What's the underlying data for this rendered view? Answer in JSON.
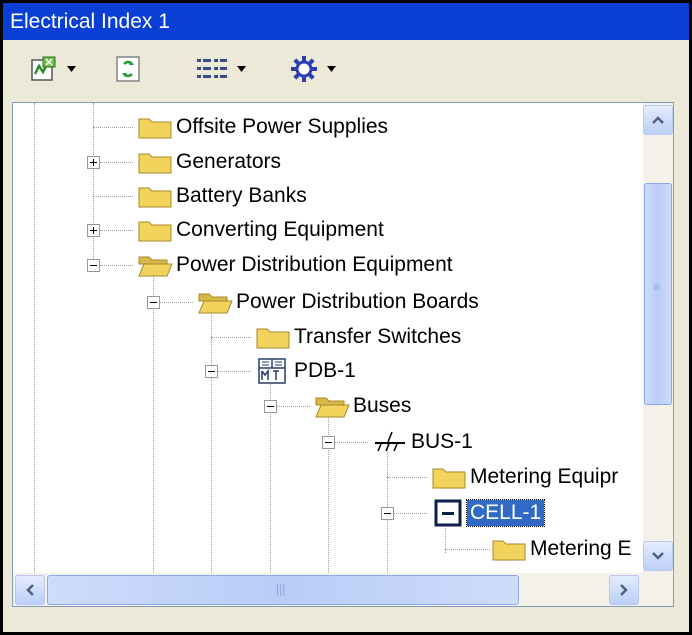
{
  "window": {
    "title": "Electrical Index 1"
  },
  "toolbar": {
    "buttons": [
      {
        "icon": "index-add-icon",
        "dropdown": true
      },
      {
        "icon": "refresh-icon",
        "dropdown": false
      },
      {
        "icon": "list-view-icon",
        "dropdown": true
      },
      {
        "icon": "gear-icon",
        "dropdown": true
      }
    ]
  },
  "tree": {
    "nodes": [
      {
        "label": "Offsite Power Supplies",
        "icon": "folder-icon",
        "expander": "none"
      },
      {
        "label": "Generators",
        "icon": "folder-icon",
        "expander": "plus"
      },
      {
        "label": "Battery Banks",
        "icon": "folder-icon",
        "expander": "none"
      },
      {
        "label": "Converting Equipment",
        "icon": "folder-icon",
        "expander": "plus"
      },
      {
        "label": "Power Distribution Equipment",
        "icon": "folder-open-icon",
        "expander": "minus"
      },
      {
        "label": "Power Distribution Boards",
        "icon": "folder-open-icon",
        "expander": "minus"
      },
      {
        "label": "Transfer Switches",
        "icon": "folder-icon",
        "expander": "none"
      },
      {
        "label": "PDB-1",
        "icon": "distribution-board-icon",
        "expander": "minus"
      },
      {
        "label": "Buses",
        "icon": "folder-open-icon",
        "expander": "minus"
      },
      {
        "label": "BUS-1",
        "icon": "bus-icon",
        "expander": "minus"
      },
      {
        "label": "Metering Equipr",
        "icon": "folder-icon",
        "expander": "none"
      },
      {
        "label": "CELL-1",
        "icon": "cell-icon",
        "expander": "minus",
        "selected": true
      },
      {
        "label": "Metering E",
        "icon": "folder-icon",
        "expander": "none"
      }
    ]
  },
  "colors": {
    "title_bar": "#0a3fd6",
    "selection": "#316ac5",
    "folder": "#f2d35c",
    "scrollbar": "#c6d6fa"
  }
}
